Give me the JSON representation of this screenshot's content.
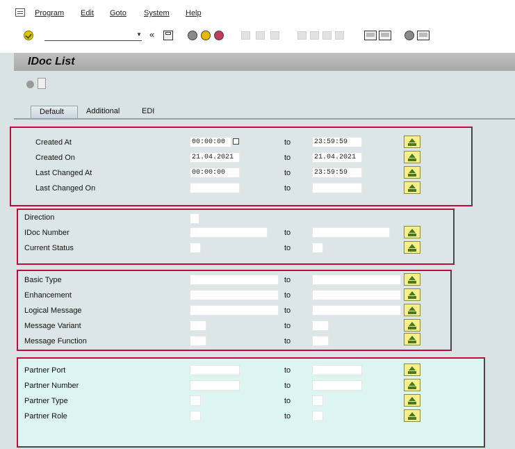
{
  "menu": {
    "items": [
      "Program",
      "Edit",
      "Goto",
      "System",
      "Help"
    ]
  },
  "toolbar": {
    "command_value": "",
    "back_label": "«"
  },
  "title": "IDoc List",
  "tabs": [
    "Default",
    "Additional",
    "EDI"
  ],
  "groups": [
    {
      "rows": [
        {
          "label": "Created At",
          "from": "00:00:00",
          "to": "23:59:59"
        },
        {
          "label": "Created On",
          "from": "21.04.2021",
          "to": "21.04.2021"
        },
        {
          "label": "Last Changed At",
          "from": "00:00:00",
          "to": "23:59:59"
        },
        {
          "label": "Last Changed On",
          "from": "",
          "to": ""
        }
      ]
    },
    {
      "rows": [
        {
          "label": "Direction",
          "from": ""
        },
        {
          "label": "IDoc Number",
          "from": "",
          "to": ""
        },
        {
          "label": "Current Status",
          "from": "",
          "to": ""
        }
      ]
    },
    {
      "rows": [
        {
          "label": "Basic Type",
          "from": "",
          "to": ""
        },
        {
          "label": "Enhancement",
          "from": "",
          "to": ""
        },
        {
          "label": "Logical Message",
          "from": "",
          "to": ""
        },
        {
          "label": "Message Variant",
          "from": "",
          "to": ""
        },
        {
          "label": "Message Function",
          "from": "",
          "to": ""
        }
      ]
    },
    {
      "rows": [
        {
          "label": "Partner Port",
          "from": "",
          "to": ""
        },
        {
          "label": "Partner Number",
          "from": "",
          "to": ""
        },
        {
          "label": "Partner Type",
          "from": "",
          "to": ""
        },
        {
          "label": "Partner Role",
          "from": "",
          "to": ""
        }
      ]
    }
  ],
  "to_label": "to",
  "colors": {
    "highlight_border": "#c0103a",
    "background": "#d9e3e3",
    "select_button": "#f7f08a"
  }
}
